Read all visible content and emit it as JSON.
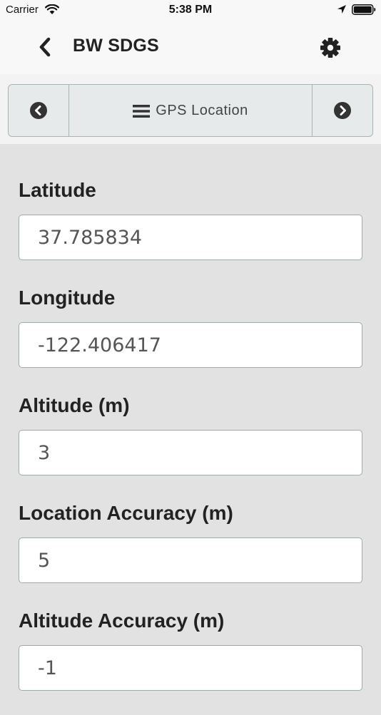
{
  "status_bar": {
    "carrier": "Carrier",
    "time": "5:38 PM",
    "icons": [
      "wifi-icon",
      "location-arrow-icon",
      "battery-icon"
    ]
  },
  "nav_bar": {
    "title": "BW SDGS",
    "back_icon": "chevron-left-icon",
    "settings_icon": "gear-icon"
  },
  "page_navigator": {
    "label": "GPS Location",
    "prev_icon": "circle-chevron-left-icon",
    "next_icon": "circle-chevron-right-icon",
    "menu_icon": "hamburger-menu-icon"
  },
  "form": {
    "fields": [
      {
        "label": "Latitude",
        "value": "37.785834"
      },
      {
        "label": "Longitude",
        "value": "-122.406417"
      },
      {
        "label": "Altitude (m)",
        "value": "3"
      },
      {
        "label": "Location Accuracy (m)",
        "value": "5"
      },
      {
        "label": "Altitude Accuracy (m)",
        "value": "-1"
      }
    ]
  },
  "colors": {
    "background": "#e2e2e2",
    "bar_background": "#f8f8f8",
    "navigator_background": "#e6eaea",
    "border": "#a9b5b2",
    "text_dark": "#222222"
  }
}
